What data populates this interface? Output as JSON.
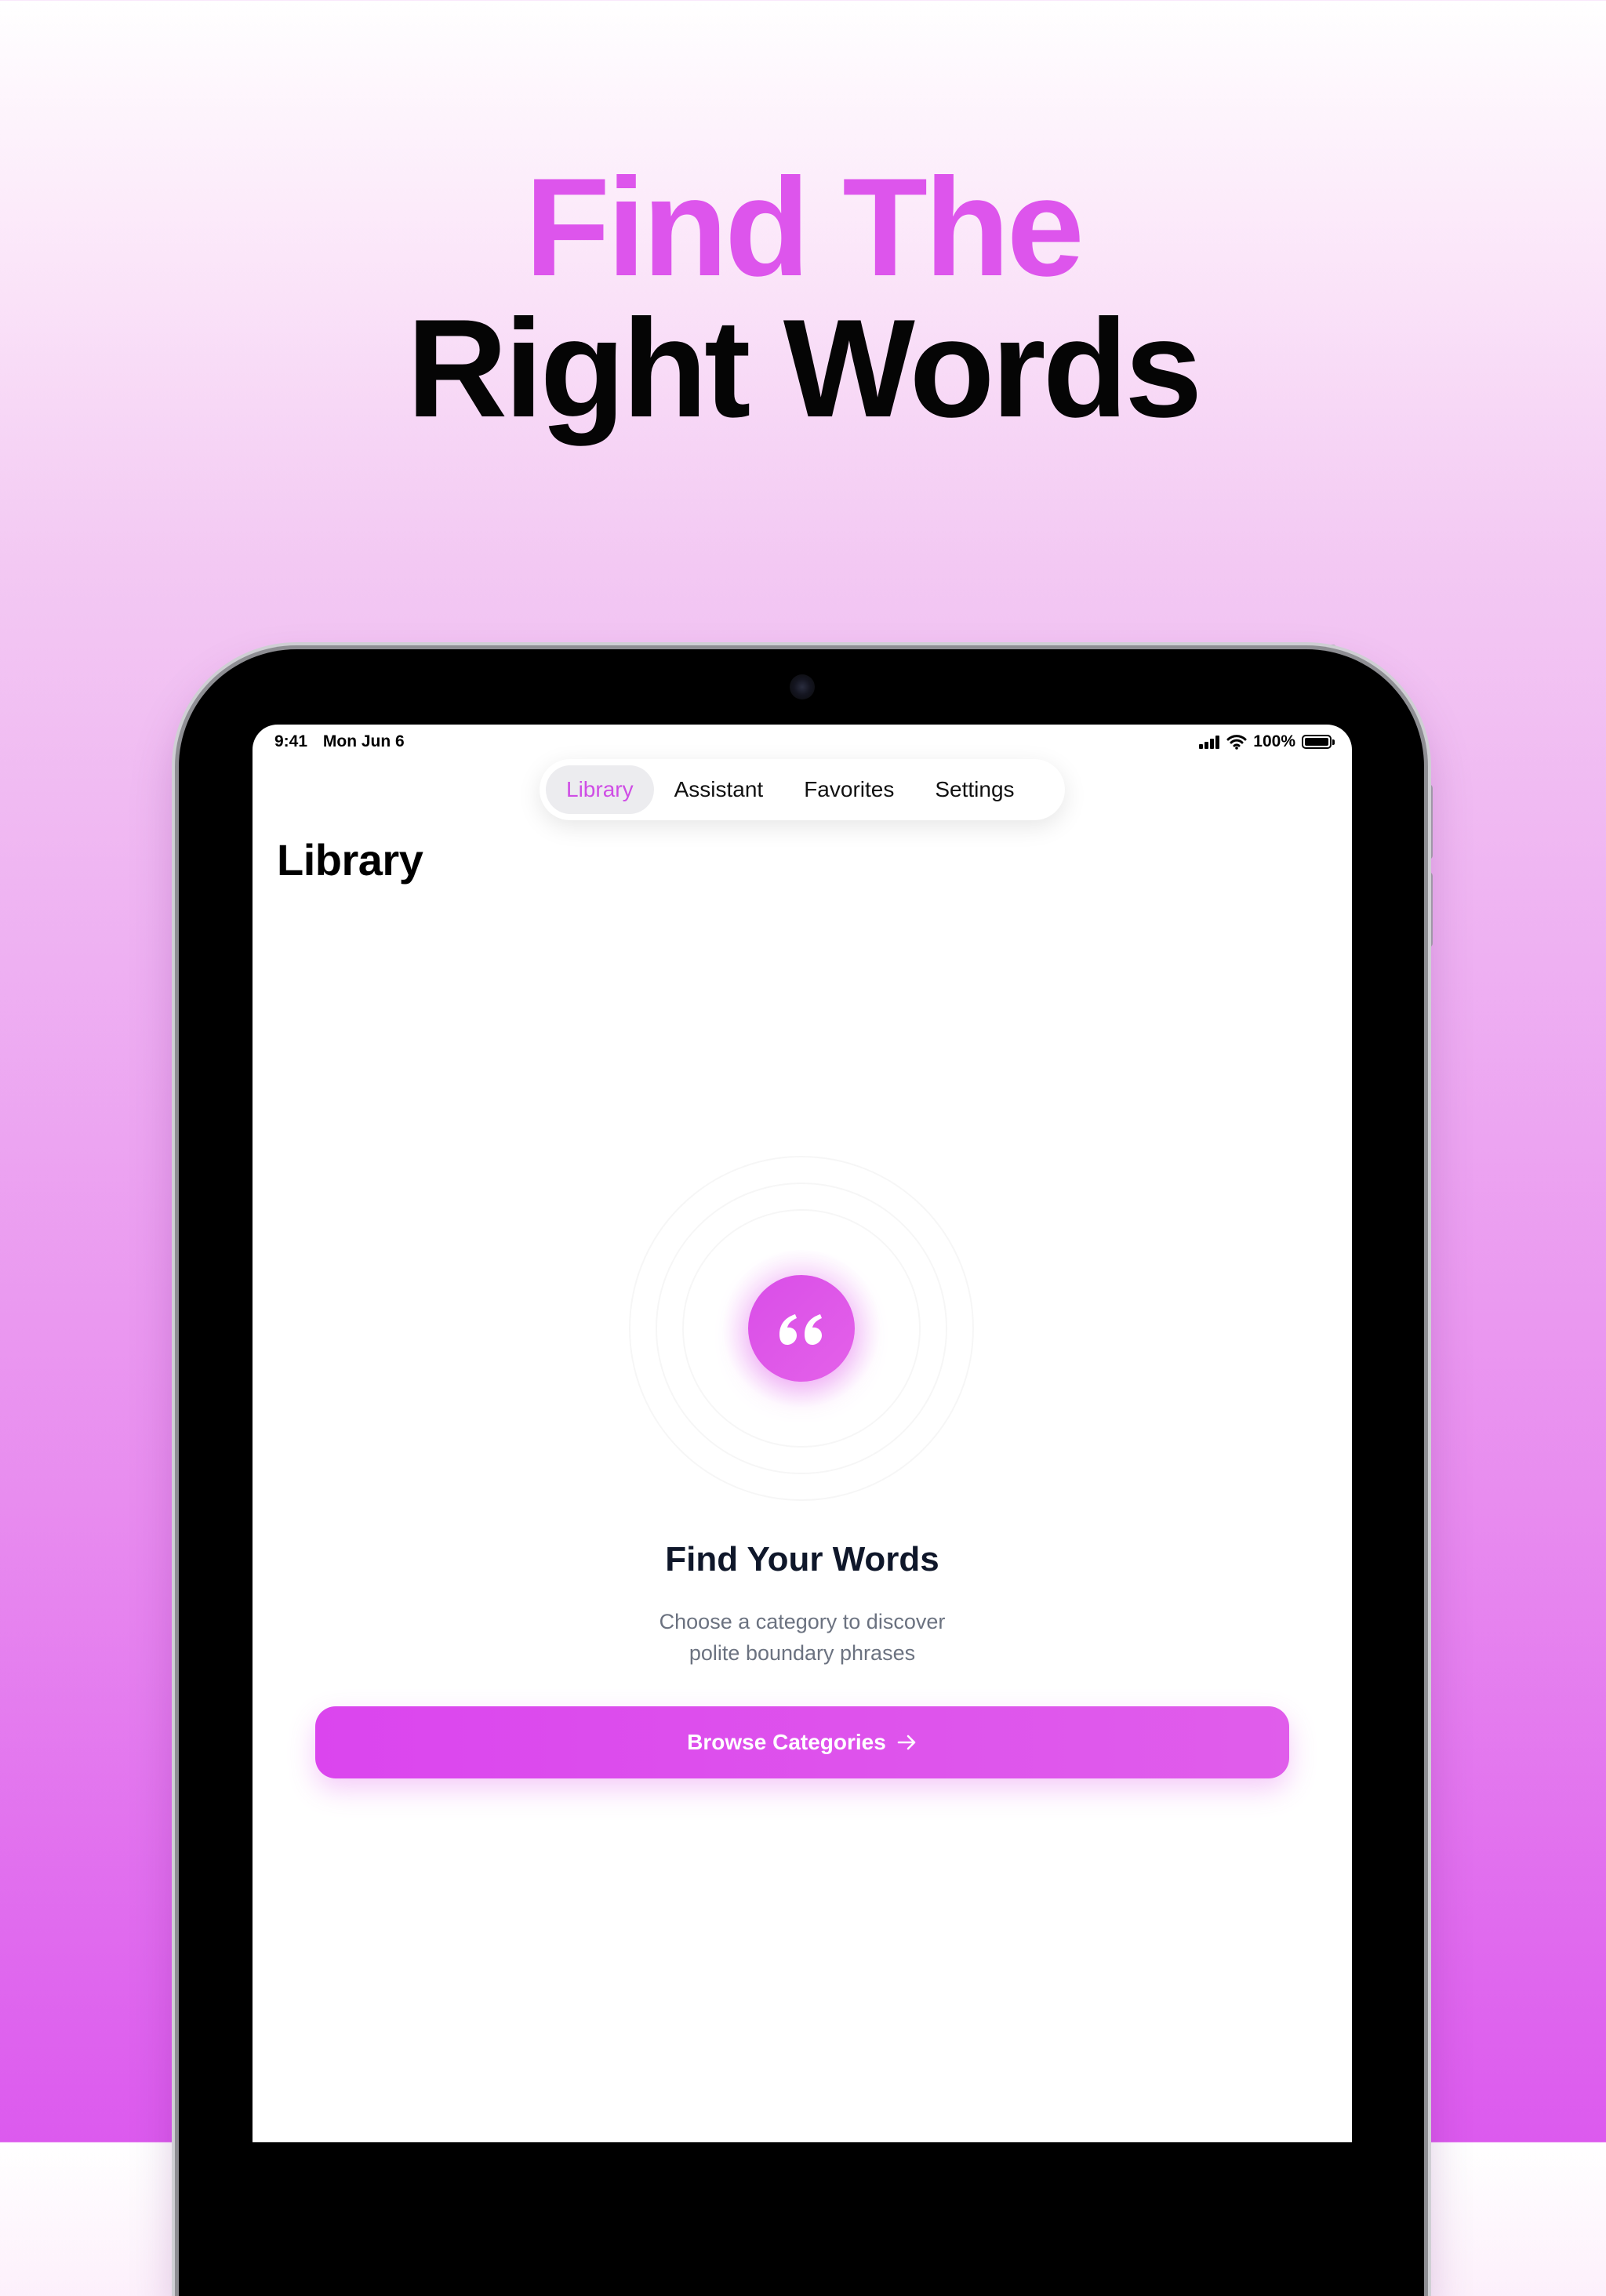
{
  "headline": {
    "line1": "Find The",
    "line2": "Right Words"
  },
  "status_bar": {
    "time": "9:41",
    "date": "Mon Jun 6",
    "battery": "100%"
  },
  "tabs": [
    {
      "label": "Library",
      "active": true
    },
    {
      "label": "Assistant",
      "active": false
    },
    {
      "label": "Favorites",
      "active": false
    },
    {
      "label": "Settings",
      "active": false
    }
  ],
  "page": {
    "title": "Library"
  },
  "empty_state": {
    "icon": "quote-icon",
    "title": "Find Your Words",
    "subtitle_line1": "Choose a category to discover",
    "subtitle_line2": "polite boundary phrases",
    "button_label": "Browse Categories",
    "button_icon": "arrow-right-icon"
  },
  "colors": {
    "accent": "#dd55ec",
    "headline_dark": "#050505",
    "title_text": "#0f172a",
    "subtitle_text": "#6b7280"
  }
}
